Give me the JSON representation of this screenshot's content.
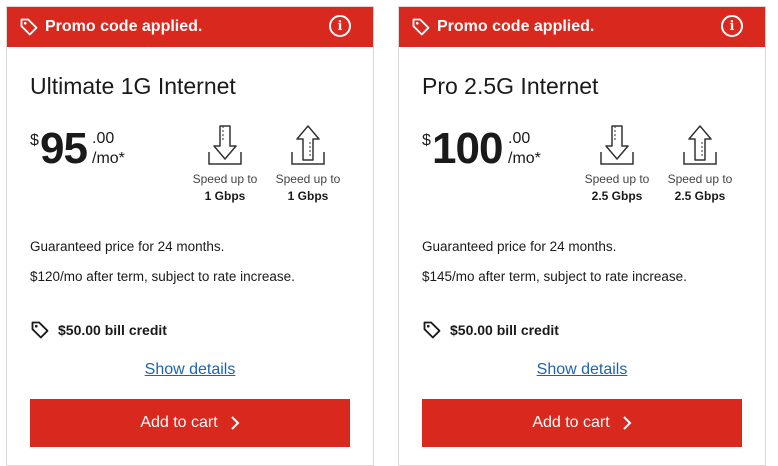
{
  "plans": [
    {
      "promo_text": "Promo code applied.",
      "title": "Ultimate 1G Internet",
      "price": {
        "currency": "$",
        "dollars": "95",
        "cents": ".00",
        "period": "/mo*"
      },
      "download": {
        "label": "Speed up to",
        "value": "1 Gbps"
      },
      "upload": {
        "label": "Speed up to",
        "value": "1 Gbps"
      },
      "guarantee": "Guaranteed price for 24 months.",
      "after_term": "$120/mo after term, subject to rate increase.",
      "credit": "$50.00 bill credit",
      "details_link": "Show details",
      "cart_button": "Add to cart"
    },
    {
      "promo_text": "Promo code applied.",
      "title": "Pro 2.5G Internet",
      "price": {
        "currency": "$",
        "dollars": "100",
        "cents": ".00",
        "period": "/mo*"
      },
      "download": {
        "label": "Speed up to",
        "value": "2.5 Gbps"
      },
      "upload": {
        "label": "Speed up to",
        "value": "2.5 Gbps"
      },
      "guarantee": "Guaranteed price for 24 months.",
      "after_term": "$145/mo after term, subject to rate increase.",
      "credit": "$50.00 bill credit",
      "details_link": "Show details",
      "cart_button": "Add to cart"
    }
  ],
  "colors": {
    "brand_red": "#d9281e",
    "link_blue": "#1d63b5"
  },
  "icons": {
    "promo": "tag-icon",
    "info": "info-icon",
    "download": "download-arrow-icon",
    "upload": "upload-arrow-icon",
    "credit": "tag-icon",
    "cart": "chevron-right-icon"
  }
}
